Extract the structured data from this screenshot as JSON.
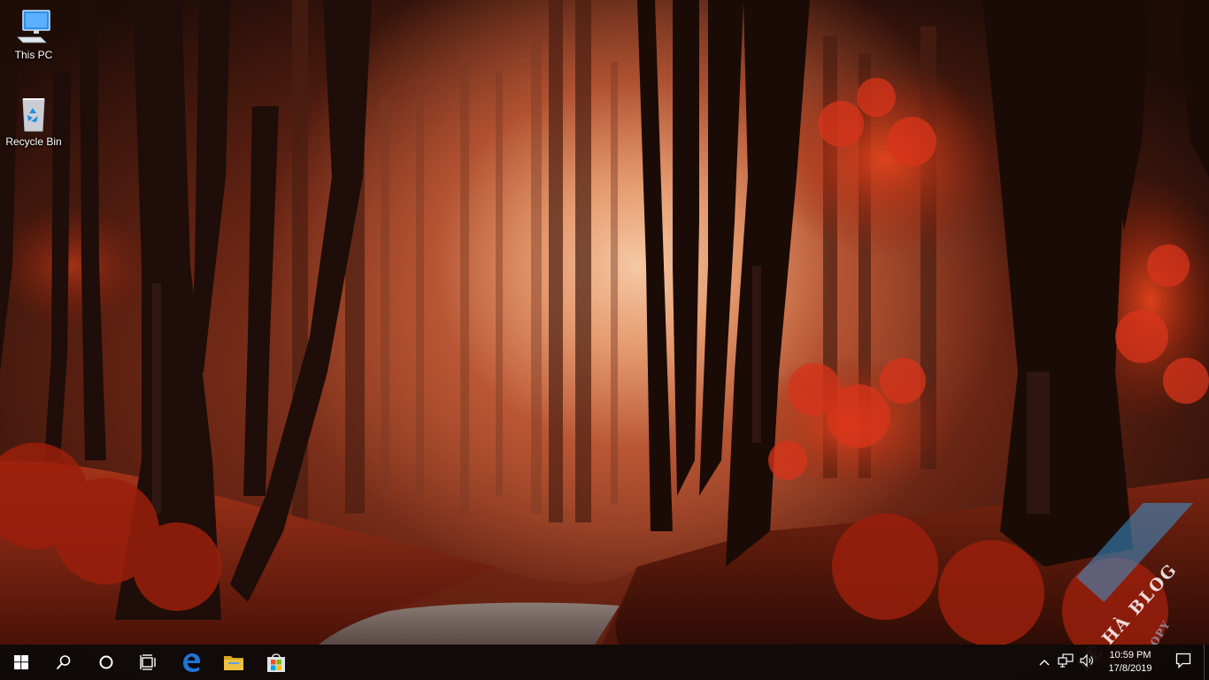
{
  "desktop": {
    "icons": [
      {
        "label": "This PC",
        "icon": "this-pc-icon"
      },
      {
        "label": "Recycle Bin",
        "icon": "recycle-bin-icon"
      }
    ],
    "wallpaper": "autumn-forest-road"
  },
  "taskbar": {
    "buttons": [
      {
        "name": "start",
        "icon": "windows-logo-icon"
      },
      {
        "name": "search",
        "icon": "search-icon"
      },
      {
        "name": "cortana",
        "icon": "circle-icon"
      },
      {
        "name": "task-view",
        "icon": "task-view-icon"
      }
    ],
    "pinned_apps": [
      {
        "name": "edge",
        "icon": "edge-icon"
      },
      {
        "name": "file-explorer",
        "icon": "folder-icon"
      },
      {
        "name": "store",
        "icon": "store-icon"
      }
    ],
    "tray": {
      "icons": [
        "chevron-up-icon",
        "network-icon",
        "speaker-icon"
      ],
      "time": "10:59 PM",
      "date": "17/8/2019"
    },
    "colors": {
      "background": "#0e0a09",
      "edge_blue": "#1e73d8",
      "folder_yellow": "#f0c040"
    }
  },
  "watermark": {
    "title": "LÊ HÀ BLOG",
    "subtitle": "NO COPY"
  }
}
